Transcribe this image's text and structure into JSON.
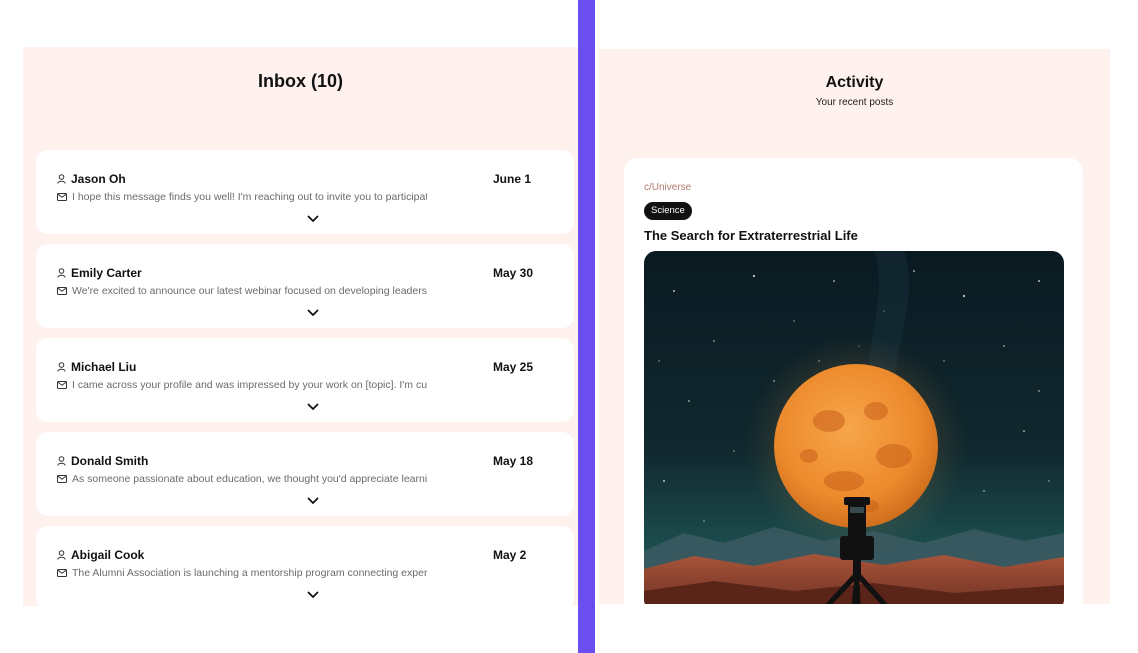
{
  "inbox": {
    "title": "Inbox (10)",
    "messages": [
      {
        "sender": "Jason Oh",
        "date": "June 1",
        "preview": "I hope this message finds you well! I'm reaching out to invite you to participat"
      },
      {
        "sender": "Emily Carter",
        "date": "May 30",
        "preview": "We're excited to announce our latest webinar focused on developing leadersl"
      },
      {
        "sender": "Michael Liu",
        "date": "May 25",
        "preview": "I came across your profile and was impressed by your work on [topic]. I'm cu"
      },
      {
        "sender": "Donald Smith",
        "date": "May 18",
        "preview": "As someone passionate about education, we thought you'd appreciate learnir"
      },
      {
        "sender": "Abigail Cook",
        "date": "May 2",
        "preview": "The Alumni Association is launching a mentorship program connecting exper"
      }
    ]
  },
  "activity": {
    "title": "Activity",
    "subtitle": "Your recent posts",
    "post": {
      "community": "c/Universe",
      "tag": "Science",
      "title": "The Search for Extraterrestrial Life"
    }
  },
  "colors": {
    "panel_bg": "#fef1ee",
    "divider": "#6a4ef0",
    "community_text": "#b07a6e"
  },
  "icons": {
    "sender": "user-icon",
    "preview": "mail-icon",
    "expand": "chevron-down-icon"
  }
}
